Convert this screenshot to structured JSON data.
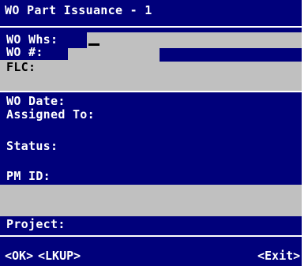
{
  "screen": {
    "title": "WO Part Issuance - 1",
    "fields": {
      "wo_whs": "WO Whs:",
      "wo_num": "WO #:",
      "flc": "FLC:",
      "wo_date": "WO Date:",
      "assigned_to": "Assigned To:",
      "status": "Status:",
      "pm_id": "PM ID:",
      "project": "Project:"
    },
    "keys": {
      "ok": "<OK>",
      "lkup": "<LKUP>",
      "exit": "<Exit>"
    }
  },
  "colors": {
    "background": "#00007b",
    "field_gray": "#c0c0c0",
    "text": "#ffffff"
  }
}
